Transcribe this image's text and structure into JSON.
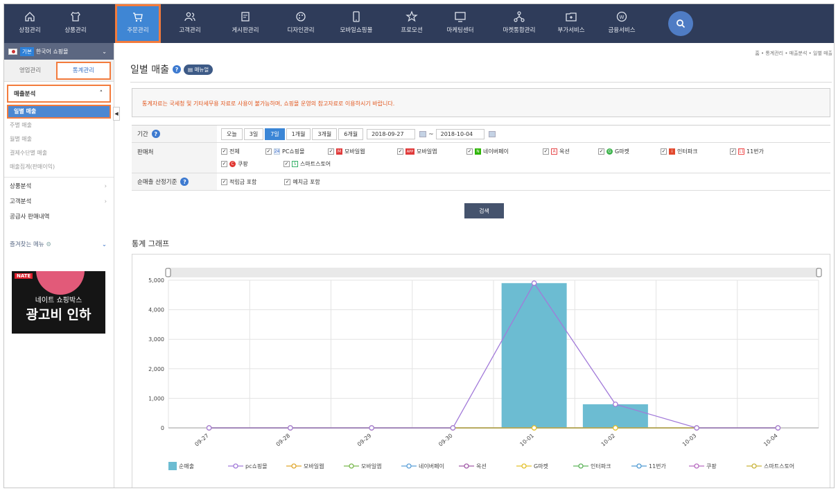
{
  "nav": {
    "items": [
      {
        "label": "상점관리",
        "icon": "home-icon"
      },
      {
        "label": "상품관리",
        "icon": "shirt-icon"
      },
      {
        "label": "주문관리",
        "icon": "cart-icon"
      },
      {
        "label": "고객관리",
        "icon": "people-icon"
      },
      {
        "label": "게시판관리",
        "icon": "board-icon"
      },
      {
        "label": "디자인관리",
        "icon": "palette-icon"
      },
      {
        "label": "모바일쇼핑몰",
        "icon": "mobile-icon"
      },
      {
        "label": "프로모션",
        "icon": "star-icon"
      },
      {
        "label": "마케팅센터",
        "icon": "monitor-icon"
      },
      {
        "label": "마켓통합관리",
        "icon": "network-icon"
      },
      {
        "label": "부가서비스",
        "icon": "folder-plus-icon"
      },
      {
        "label": "금융서비스",
        "icon": "coin-icon"
      }
    ],
    "active_index": 2
  },
  "sidebar": {
    "shop_badge": "기본",
    "shop_name": "한국어 쇼핑몰",
    "tabs": [
      "영업관리",
      "통계관리"
    ],
    "section_title": "매출분석",
    "items": [
      "일별 매출",
      "주별 매출",
      "월별 매출",
      "결제수단별 매출",
      "매출집계(판매이익)"
    ],
    "groups": [
      "상품분석",
      "고객분석",
      "공급사 판매내역"
    ],
    "favorites": "즐겨찾는 메뉴",
    "ad": {
      "brand": "NATE",
      "line1": "네이트 쇼핑박스",
      "line2": "광고비 인하"
    }
  },
  "page": {
    "breadcrumb": "홈 • 통계관리 • 매출분석 • 일별 매출",
    "title": "일별 매출",
    "manual_label": "매뉴얼",
    "notice": "통계자료는 국세청 및 기타세무용 자료로 사용이 불가능하며, 쇼핑몰 운영의 참고자료로 이용하시기 바랍니다."
  },
  "filters": {
    "period_label": "기간",
    "period_buttons": [
      "오늘",
      "3일",
      "7일",
      "1개월",
      "3개월",
      "6개월"
    ],
    "period_active": 2,
    "date_from": "2018-09-27",
    "date_to": "2018-10-04",
    "date_sep": "~",
    "channel_label": "판매처",
    "channels": [
      {
        "label": "전체",
        "mark": "",
        "color": ""
      },
      {
        "label": "PC쇼핑몰",
        "mark": "24",
        "color": "#e7eefc"
      },
      {
        "label": "모바일웹",
        "mark": "M",
        "color": "#e03a3a"
      },
      {
        "label": "모바일앱",
        "mark": "APP",
        "color": "#e03a3a"
      },
      {
        "label": "네이버페이",
        "mark": "N",
        "color": "#2db400"
      },
      {
        "label": "옥션",
        "mark": "A",
        "color": "#e6494b"
      },
      {
        "label": "G마켓",
        "mark": "G",
        "color": "#3bb34a"
      },
      {
        "label": "인터파크",
        "mark": "i",
        "color": "#e24a2f"
      },
      {
        "label": "11번가",
        "mark": "11",
        "color": "#ef4a4a"
      },
      {
        "label": "쿠팡",
        "mark": "C",
        "color": "#e0342f"
      },
      {
        "label": "스마트스토어",
        "mark": "S",
        "color": "#34b067"
      }
    ],
    "basis_label": "순매출 산정기준",
    "basis": [
      "적립금 포함",
      "예치금 포함"
    ],
    "search_label": "검색"
  },
  "chart_section": {
    "title": "통계 그래프"
  },
  "chart_data": {
    "type": "bar",
    "categories": [
      "09-27",
      "09-28",
      "09-29",
      "09-30",
      "10-01",
      "10-02",
      "10-03",
      "10-04"
    ],
    "ylim": [
      0,
      5000
    ],
    "yticks": [
      0,
      1000,
      2000,
      3000,
      4000,
      5000
    ],
    "ytick_labels": [
      "0",
      "1,000",
      "2,000",
      "3,000",
      "4,000",
      "5,000"
    ],
    "grid": true,
    "legend_position": "bottom",
    "series": [
      {
        "name": "순매출",
        "kind": "bar",
        "color": "#6cbcd2",
        "values": [
          0,
          0,
          0,
          0,
          4900,
          800,
          0,
          0
        ]
      },
      {
        "name": "pc쇼핑몰",
        "kind": "line",
        "color": "#a27ad9",
        "values": [
          0,
          0,
          0,
          0,
          4900,
          800,
          0,
          0
        ]
      },
      {
        "name": "모바일웹",
        "kind": "line",
        "color": "#e0a72f",
        "values": [
          0,
          0,
          0,
          0,
          0,
          0,
          0,
          0
        ]
      },
      {
        "name": "모바일앱",
        "kind": "line",
        "color": "#79b84d",
        "values": [
          0,
          0,
          0,
          0,
          0,
          0,
          0,
          0
        ]
      },
      {
        "name": "네이버페이",
        "kind": "line",
        "color": "#5a9fd8",
        "values": [
          0,
          0,
          0,
          0,
          0,
          0,
          0,
          0
        ]
      },
      {
        "name": "옥션",
        "kind": "line",
        "color": "#a25aa8",
        "values": [
          0,
          0,
          0,
          0,
          0,
          0,
          0,
          0
        ]
      },
      {
        "name": "G마켓",
        "kind": "line",
        "color": "#e3c02a",
        "values": [
          0,
          0,
          0,
          0,
          0,
          0,
          0,
          0
        ]
      },
      {
        "name": "인터파크",
        "kind": "line",
        "color": "#5db35a",
        "values": [
          0,
          0,
          0,
          0,
          0,
          0,
          0,
          0
        ]
      },
      {
        "name": "11번가",
        "kind": "line",
        "color": "#4f9bd3",
        "values": [
          0,
          0,
          0,
          0,
          0,
          0,
          0,
          0
        ]
      },
      {
        "name": "쿠팡",
        "kind": "line",
        "color": "#b76ac0",
        "values": [
          0,
          0,
          0,
          0,
          0,
          0,
          0,
          0
        ]
      },
      {
        "name": "스마트스토어",
        "kind": "line",
        "color": "#c9b43a",
        "values": [
          0,
          0,
          0,
          0,
          0,
          0,
          0,
          0
        ]
      }
    ]
  }
}
